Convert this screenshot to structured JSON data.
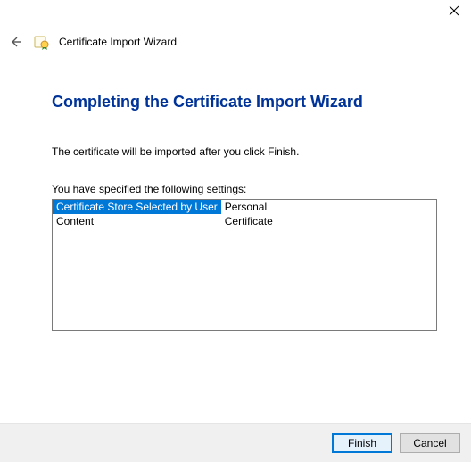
{
  "header": {
    "wizard_title": "Certificate Import Wizard"
  },
  "content": {
    "heading": "Completing the Certificate Import Wizard",
    "description": "The certificate will be imported after you click Finish.",
    "settings_intro": "You have specified the following settings:",
    "settings": [
      {
        "key": "Certificate Store Selected by User",
        "value": "Personal",
        "selected": true
      },
      {
        "key": "Content",
        "value": "Certificate",
        "selected": false
      }
    ]
  },
  "footer": {
    "finish_label": "Finish",
    "cancel_label": "Cancel"
  },
  "icons": {
    "back": "back-arrow-icon",
    "close": "close-icon",
    "wizard": "certificate-wizard-icon"
  },
  "colors": {
    "heading": "#003399",
    "selection_bg": "#0078d7",
    "footer_bg": "#f0f0f0",
    "button_default_border": "#0078d7"
  }
}
